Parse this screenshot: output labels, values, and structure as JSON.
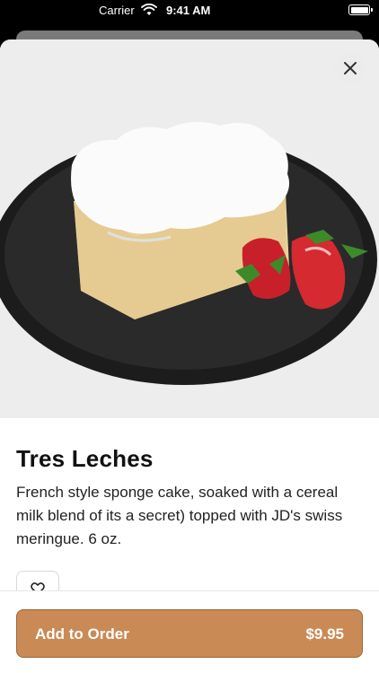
{
  "status_bar": {
    "carrier": "Carrier",
    "time": "9:41 AM"
  },
  "close_icon": "close-icon",
  "item": {
    "name": "Tres Leches",
    "description": "French style sponge cake, soaked with a cereal milk blend of its a secret) topped with JD's swiss meringue. 6 oz.",
    "image_alt": "Tres Leches cake slice with strawberries on a black plate"
  },
  "favorite_icon": "heart-icon",
  "order": {
    "label": "Add to Order",
    "price": "$9.95"
  },
  "colors": {
    "accent": "#c98a55",
    "accent_border": "#9c6638"
  }
}
